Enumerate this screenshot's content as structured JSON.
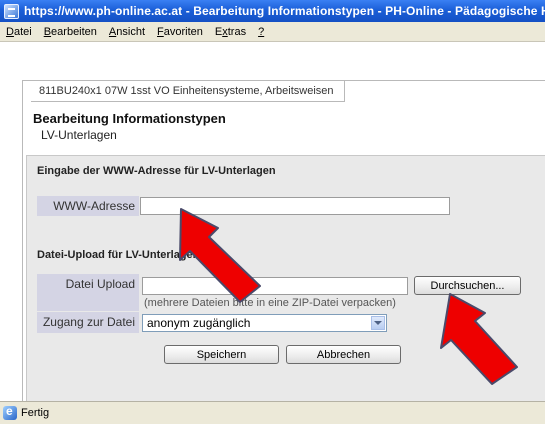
{
  "window": {
    "title": "https://www.ph-online.ac.at - Bearbeitung Informationstypen - PH-Online - Pädagogische Hochs"
  },
  "menu": {
    "items": [
      {
        "pre": "",
        "u": "D",
        "post": "atei"
      },
      {
        "pre": "",
        "u": "B",
        "post": "earbeiten"
      },
      {
        "pre": "",
        "u": "A",
        "post": "nsicht"
      },
      {
        "pre": "",
        "u": "F",
        "post": "avoriten"
      },
      {
        "pre": "E",
        "u": "x",
        "post": "tras"
      },
      {
        "pre": "",
        "u": "?",
        "post": ""
      }
    ]
  },
  "course_tab": "811BU240x1 07W 1sst VO Einheitensysteme, Arbeitsweisen",
  "page": {
    "title": "Bearbeitung Informationstypen",
    "subtitle": "LV-Unterlagen"
  },
  "form": {
    "www_section": "Eingabe der WWW-Adresse für LV-Unterlagen",
    "www_label": "WWW-Adresse",
    "www_value": "",
    "upload_section": "Datei-Upload für LV-Unterlagen",
    "upload_label": "Datei Upload",
    "upload_value": "",
    "browse_button": "Durchsuchen...",
    "upload_hint": "(mehrere Dateien bitte in eine ZIP-Datei verpacken)",
    "access_label": "Zugang zur Datei",
    "access_selected": "anonym zugänglich",
    "save_button": "Speichern",
    "cancel_button": "Abbrechen"
  },
  "status": {
    "text": "Fertig"
  },
  "colors": {
    "titlebar": "#1b5fd8",
    "label_bg": "#d4d4e4",
    "panel_bg": "#e9e9e9",
    "arrow_fill": "#ee0000",
    "arrow_stroke": "#4a4a6a"
  }
}
